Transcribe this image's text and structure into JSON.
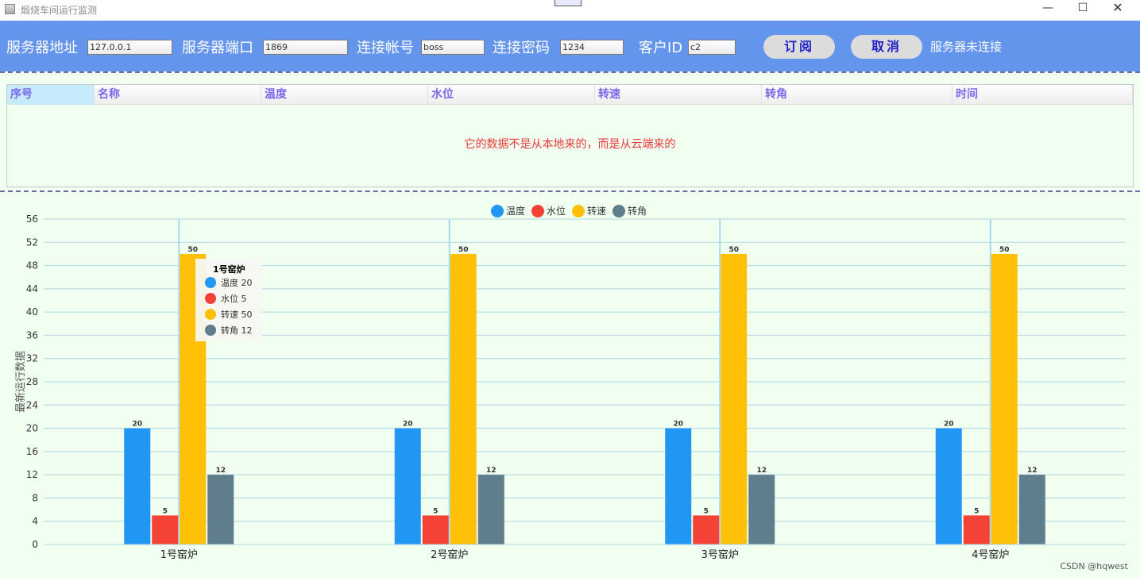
{
  "window": {
    "title": "煅烧车间运行监测",
    "minimize_glyph": "—",
    "maximize_glyph": "☐",
    "close_glyph": "✕"
  },
  "toolbar": {
    "server_address_label": "服务器地址",
    "server_address_value": "127.0.0.1",
    "server_port_label": "服务器端口",
    "server_port_value": "1869",
    "account_label": "连接帐号",
    "account_value": "boss",
    "password_label": "连接密码",
    "password_value": "1234",
    "client_id_label": "客户ID",
    "client_id_value": "c2",
    "subscribe_button": "订阅",
    "cancel_button": "取消",
    "status_text": "服务器未连接"
  },
  "table": {
    "columns": [
      "序号",
      "名称",
      "温度",
      "水位",
      "转速",
      "转角",
      "时间"
    ],
    "empty_message": "它的数据不是从本地来的，而是从云端来的"
  },
  "chart_data": {
    "type": "bar",
    "categories": [
      "1号窑炉",
      "2号窑炉",
      "3号窑炉",
      "4号窑炉"
    ],
    "series": [
      {
        "name": "温度",
        "values": [
          20,
          20,
          20,
          20
        ],
        "color": "#2196f3"
      },
      {
        "name": "水位",
        "values": [
          5,
          5,
          5,
          5
        ],
        "color": "#f44336"
      },
      {
        "name": "转速",
        "values": [
          50,
          50,
          50,
          50
        ],
        "color": "#ffc107"
      },
      {
        "name": "转角",
        "values": [
          12,
          12,
          12,
          12
        ],
        "color": "#607d8b"
      }
    ],
    "ylabel": "最新运行数据",
    "ylim": [
      0,
      56
    ],
    "yticks": [
      0,
      4,
      8,
      12,
      16,
      20,
      24,
      28,
      32,
      36,
      40,
      44,
      48,
      52,
      56
    ],
    "grid": true,
    "legend_position": "top-center",
    "tooltip": {
      "title": "1号窑炉",
      "items": [
        {
          "name": "温度",
          "value": 20
        },
        {
          "name": "水位",
          "value": 5
        },
        {
          "name": "转速",
          "value": 50
        },
        {
          "name": "转角",
          "value": 12
        }
      ]
    }
  },
  "watermark": "CSDN @hqwest"
}
